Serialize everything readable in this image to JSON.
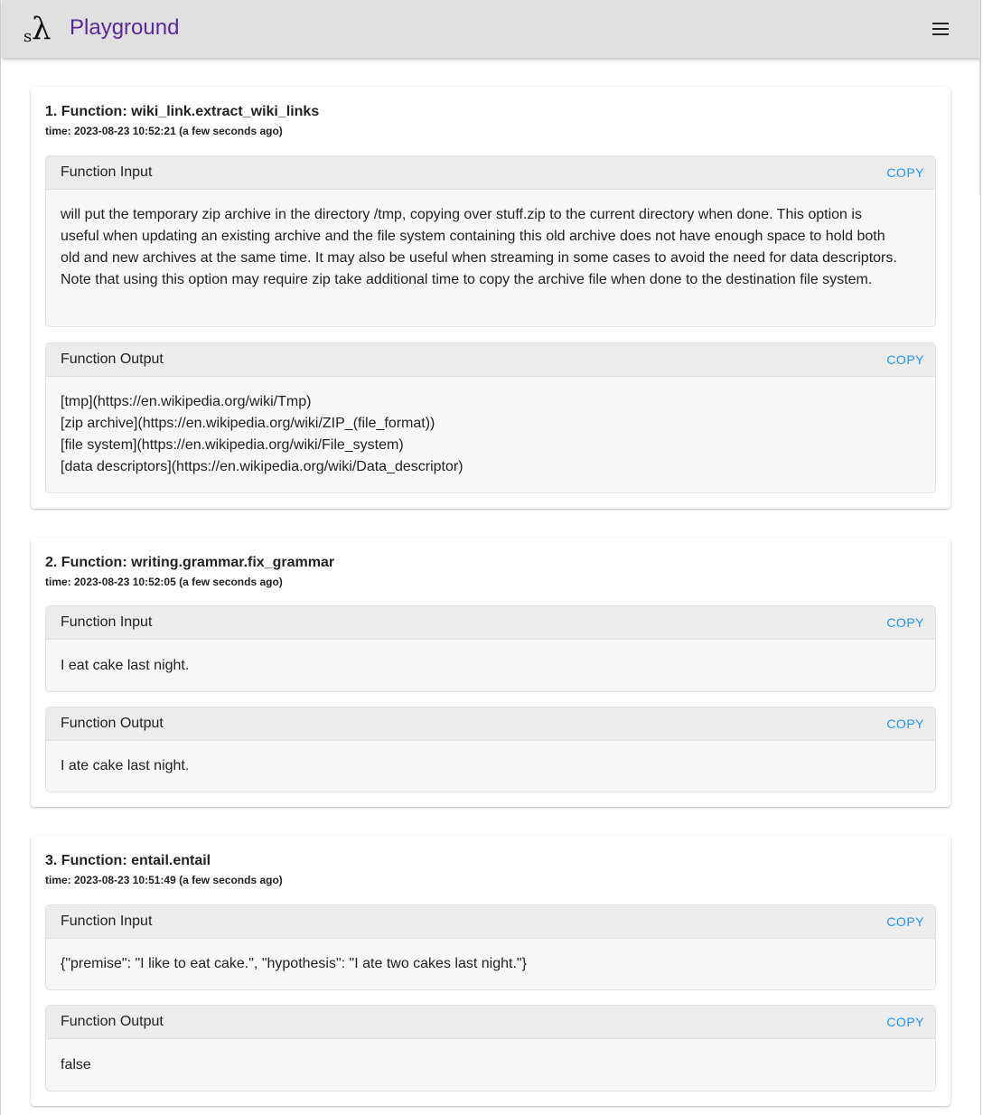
{
  "app": {
    "logo_s": "s",
    "logo_lambda": "λ",
    "title": "Playground",
    "menu_icon": "hamburger-menu-icon"
  },
  "entries": [
    {
      "title": "1. Function: wiki_link.extract_wiki_links",
      "time": "time: 2023-08-23 10:52:21 (a few seconds ago)",
      "input_label": "Function Input",
      "input_copy": "COPY",
      "input_lines": [
        "will put the temporary zip archive in the directory /tmp, copying over stuff.zip to the current directory when done. This option is",
        "useful when updating an existing archive and the file system containing this old archive does not have enough space to hold both",
        "old and new archives at the same time. It may also be useful when streaming in some cases to avoid the need for data descriptors.",
        "Note that using this option may require zip take additional time to copy the archive file when done to the destination file system."
      ],
      "output_label": "Function Output",
      "output_copy": "COPY",
      "output_lines": [
        "[tmp](https://en.wikipedia.org/wiki/Tmp)",
        "[zip archive](https://en.wikipedia.org/wiki/ZIP_(file_format))",
        "[file system](https://en.wikipedia.org/wiki/File_system)",
        "[data descriptors](https://en.wikipedia.org/wiki/Data_descriptor)"
      ]
    },
    {
      "title": "2. Function: writing.grammar.fix_grammar",
      "time": "time: 2023-08-23 10:52:05 (a few seconds ago)",
      "input_label": "Function Input",
      "input_copy": "COPY",
      "input_lines": [
        "I eat cake last night."
      ],
      "output_label": "Function Output",
      "output_copy": "COPY",
      "output_lines": [
        "I ate cake last night."
      ]
    },
    {
      "title": "3. Function: entail.entail",
      "time": "time: 2023-08-23 10:51:49 (a few seconds ago)",
      "input_label": "Function Input",
      "input_copy": "COPY",
      "input_lines": [
        "{\"premise\": \"I like to eat cake.\", \"hypothesis\": \"I ate two cakes last night.\"}"
      ],
      "output_label": "Function Output",
      "output_copy": "COPY",
      "output_lines": [
        "false"
      ]
    }
  ]
}
